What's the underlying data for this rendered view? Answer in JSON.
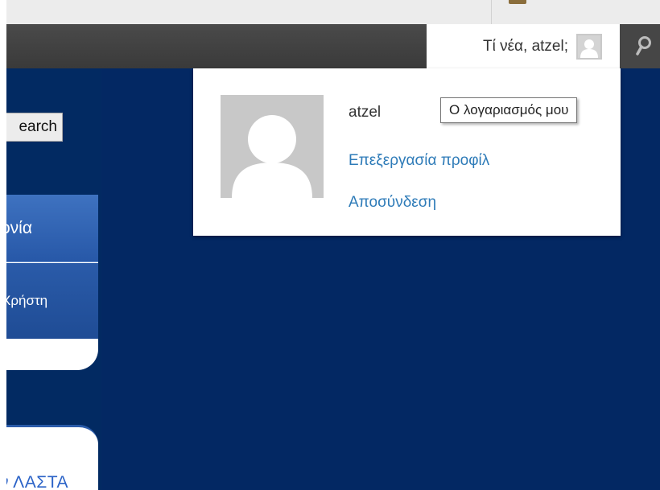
{
  "admin_bar": {
    "howdy_text": "Τί νέα, atzel;",
    "search_icon": "search-icon",
    "avatar_icon": "user-avatar-icon"
  },
  "dropdown": {
    "username": "atzel",
    "edit_profile": "Επεξεργασία προφίλ",
    "logout": "Αποσύνδεση"
  },
  "tooltip": {
    "text": "Ο λογαριασμός μου"
  },
  "sidebar": {
    "search_button": "earch",
    "nav_items": [
      {
        "label": "ονία"
      },
      {
        "label": "Χρήστη"
      }
    ],
    "bottom_link": "ν ΛΑΣΤΑ"
  },
  "colors": {
    "admin_bar_bg": "#3e3e3e",
    "page_bg": "#032863",
    "nav_blue": "#2f63b2",
    "link_blue": "#2e7bb8",
    "avatar_gray": "#c8c8c8"
  }
}
